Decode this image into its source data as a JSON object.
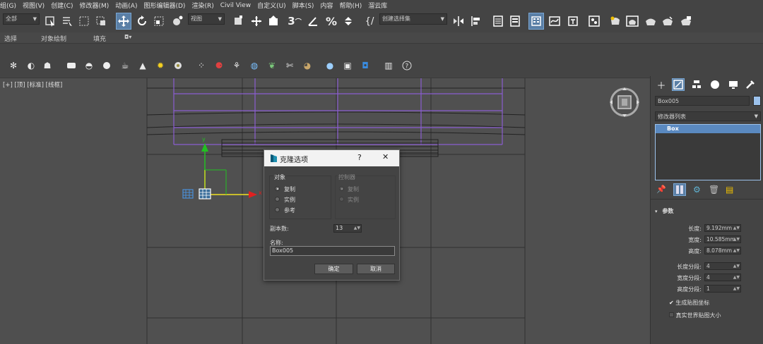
{
  "menu": [
    "组(G)",
    "视图(V)",
    "创建(C)",
    "修改器(M)",
    "动画(A)",
    "图形编辑器(D)",
    "渲染(R)",
    "Civil View",
    "自定义(U)",
    "脚本(S)",
    "内容",
    "帮助(H)",
    "溜云库"
  ],
  "toolbar": {
    "selection_filter": "全部",
    "ref_coord": "视图",
    "named_selection": "创建选择集"
  },
  "ribbon_tabs": [
    "选择",
    "对象绘制",
    "填充"
  ],
  "viewport": {
    "label": "[+] [顶] [标准] [线框]",
    "gizmo_axis_y": "y",
    "gizmo_axis_x": "x"
  },
  "command_panel": {
    "object_name": "Box005",
    "modifier_list": "修改器列表",
    "stack_item": "Box",
    "rollout_title": "参数",
    "params": [
      {
        "label": "长度:",
        "value": "9.192mm"
      },
      {
        "label": "宽度:",
        "value": "10.585mm"
      },
      {
        "label": "高度:",
        "value": "8.078mm"
      },
      {
        "label": "长度分段:",
        "value": "4"
      },
      {
        "label": "宽度分段:",
        "value": "4"
      },
      {
        "label": "高度分段:",
        "value": "1"
      }
    ],
    "checkbox_gen_map": "生成贴图坐标",
    "checkbox_real_world": "真实世界贴图大小"
  },
  "dialog": {
    "title": "克隆选项",
    "help": "?",
    "close": "✕",
    "object_group": "对象",
    "object_options": [
      "复制",
      "实例",
      "参考"
    ],
    "controller_group": "控制器",
    "controller_options": [
      "复制",
      "实例"
    ],
    "copies_label": "副本数:",
    "copies_value": "13",
    "name_label": "名称:",
    "name_value": "Box005",
    "ok": "确定",
    "cancel": "取消"
  },
  "colors": {
    "accent": "#5a7fa6",
    "viewport_bg": "#4f4f4f",
    "wire_purple": "#8a5cd0",
    "gizmo_green": "#22c022",
    "gizmo_red": "#e02020",
    "gizmo_yellow": "#f0e020"
  }
}
